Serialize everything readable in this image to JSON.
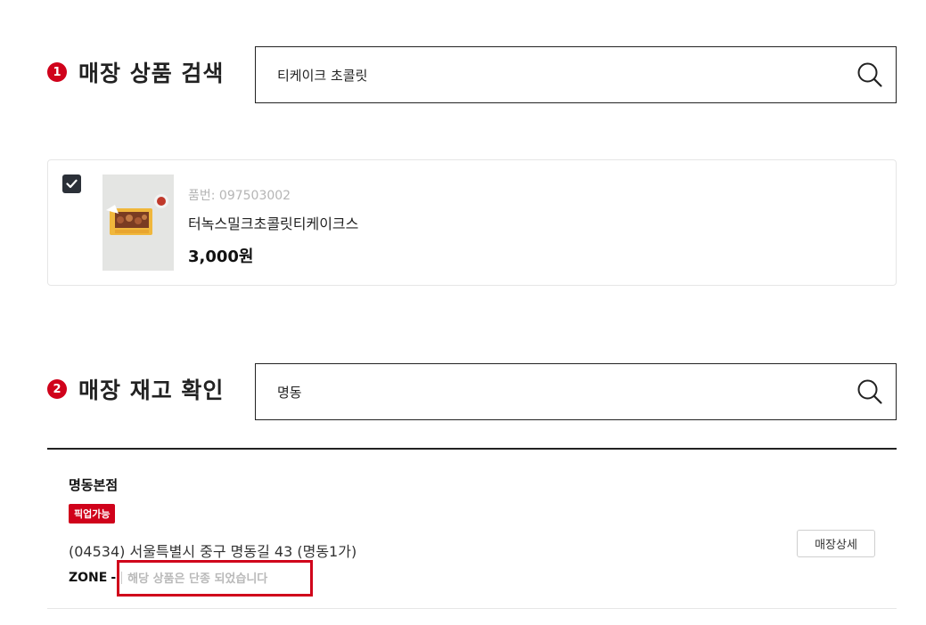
{
  "section1": {
    "step": "1",
    "title": "매장 상품 검색",
    "search_value": "티케이크 초콜릿"
  },
  "product": {
    "checked": true,
    "code": "품번: 097503002",
    "name": "터녹스밀크초콜릿티케이크스",
    "price": "3,000원"
  },
  "section2": {
    "step": "2",
    "title": "매장 재고 확인",
    "search_value": "명동"
  },
  "store": {
    "name": "명동본점",
    "badge": "픽업가능",
    "address": "(04534) 서울특별시 중구 명동길 43 (명동1가)",
    "zone_label": "ZONE",
    "zone_sep": "-",
    "zone_message": "해당 상품은 단종 되었습니다",
    "detail_button": "매장상세"
  },
  "colors": {
    "accent": "#d0021b",
    "checkbox": "#2b3038"
  }
}
